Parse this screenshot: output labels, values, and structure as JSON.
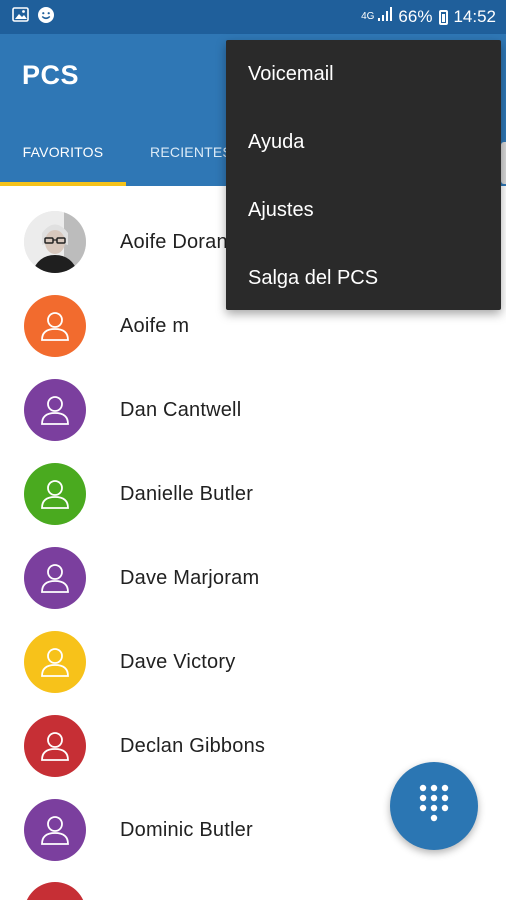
{
  "status_bar": {
    "network": "4G",
    "battery": "66%",
    "time": "14:52"
  },
  "app": {
    "title": "PCS"
  },
  "tabs": [
    {
      "label": "FAVORITOS",
      "selected": true
    },
    {
      "label": "RECIENTES",
      "selected": false
    }
  ],
  "contacts": [
    {
      "name": "Aoife Doran",
      "avatar": "photo",
      "color": "#e9e9e9"
    },
    {
      "name": "Aoife m",
      "avatar": "person-icon",
      "color": "#f26b2e"
    },
    {
      "name": "Dan Cantwell",
      "avatar": "person-icon",
      "color": "#7b3f9e"
    },
    {
      "name": "Danielle Butler",
      "avatar": "person-icon",
      "color": "#4aaa1f"
    },
    {
      "name": "Dave Marjoram",
      "avatar": "person-icon",
      "color": "#7b3f9e"
    },
    {
      "name": "Dave Victory",
      "avatar": "person-icon",
      "color": "#f7c21a"
    },
    {
      "name": "Declan Gibbons",
      "avatar": "person-icon",
      "color": "#c62f35"
    },
    {
      "name": "Dominic Butler",
      "avatar": "person-icon",
      "color": "#7b3f9e"
    }
  ],
  "overflow_menu": {
    "items": [
      "Voicemail",
      "Ayuda",
      "Ajustes",
      "Salga del PCS"
    ]
  },
  "fab": {
    "icon": "dialpad-icon"
  },
  "colors": {
    "status_bar": "#1f5f9b",
    "app_bar": "#2f77b5",
    "tab_indicator": "#f5c21a",
    "menu_background": "#2a2a2a"
  }
}
